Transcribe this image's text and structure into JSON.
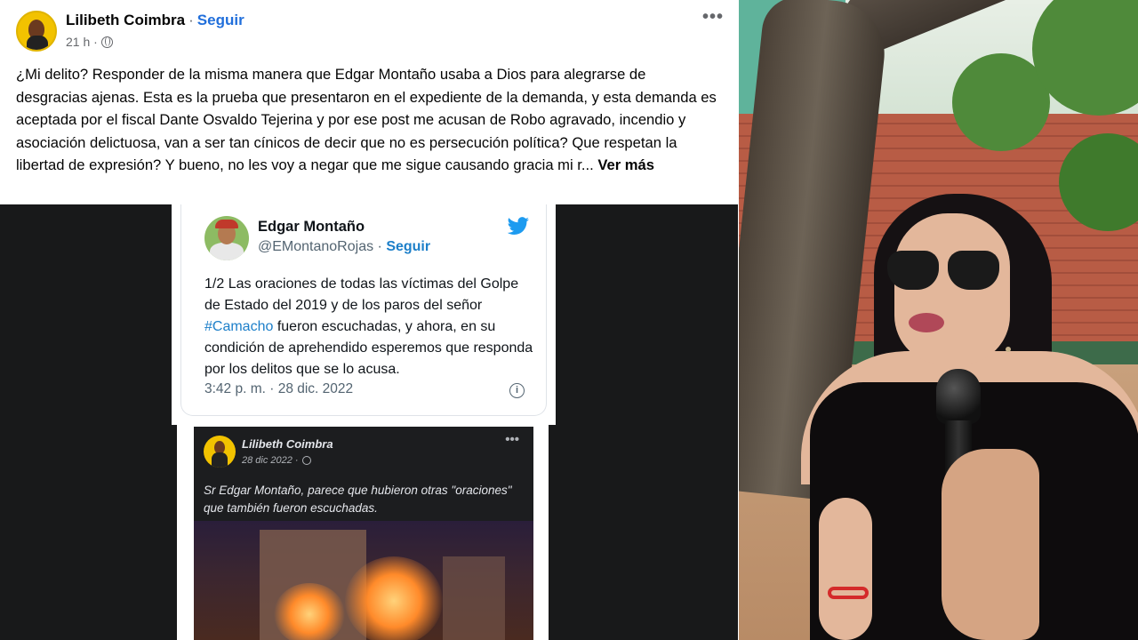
{
  "post": {
    "author": "Lilibeth Coimbra",
    "separator": "·",
    "follow_label": "Seguir",
    "time": "21 h ·",
    "more_label": "•••",
    "text": "¿Mi delito? Responder de la misma manera que Edgar Montaño usaba a Dios para alegrarse de desgracias ajenas. Esta es la prueba que presentaron en el  expediente de la demanda, y esta demanda es aceptada por el fiscal Dante Osvaldo Tejerina y por ese post me acusan de Robo agravado, incendio y asociación delictuosa, van a ser tan cínicos de decir que no es persecución política? Que respetan la libertad de expresión? Y bueno, no les voy a negar que me sigue causando gracia mi r...",
    "see_more": "Ver más"
  },
  "tweet": {
    "name": "Edgar Montaño",
    "handle": "@EMontanoRojas ·",
    "follow_label": "Seguir",
    "text_before": "1/2 Las oraciones de todas las víctimas del Golpe de Estado del 2019 y de los paros del señor ",
    "hashtag": "#Camacho",
    "text_after": " fueron escuchadas, y ahora, en su condición de aprehendido esperemos que responda por los delitos que se lo acusa.",
    "timestamp": "3:42 p. m. · 28 dic. 2022",
    "info_symbol": "i"
  },
  "nested_post": {
    "author": "Lilibeth Coimbra",
    "date": "28 dic 2022 ·",
    "more_label": "•••",
    "text": "Sr Edgar Montaño, parece que hubieron otras \"oraciones\" que también fueron escuchadas."
  },
  "colors": {
    "facebook_link": "#216fdb",
    "twitter_blue": "#1d9bf0",
    "dark_media_bg": "#18191a"
  }
}
